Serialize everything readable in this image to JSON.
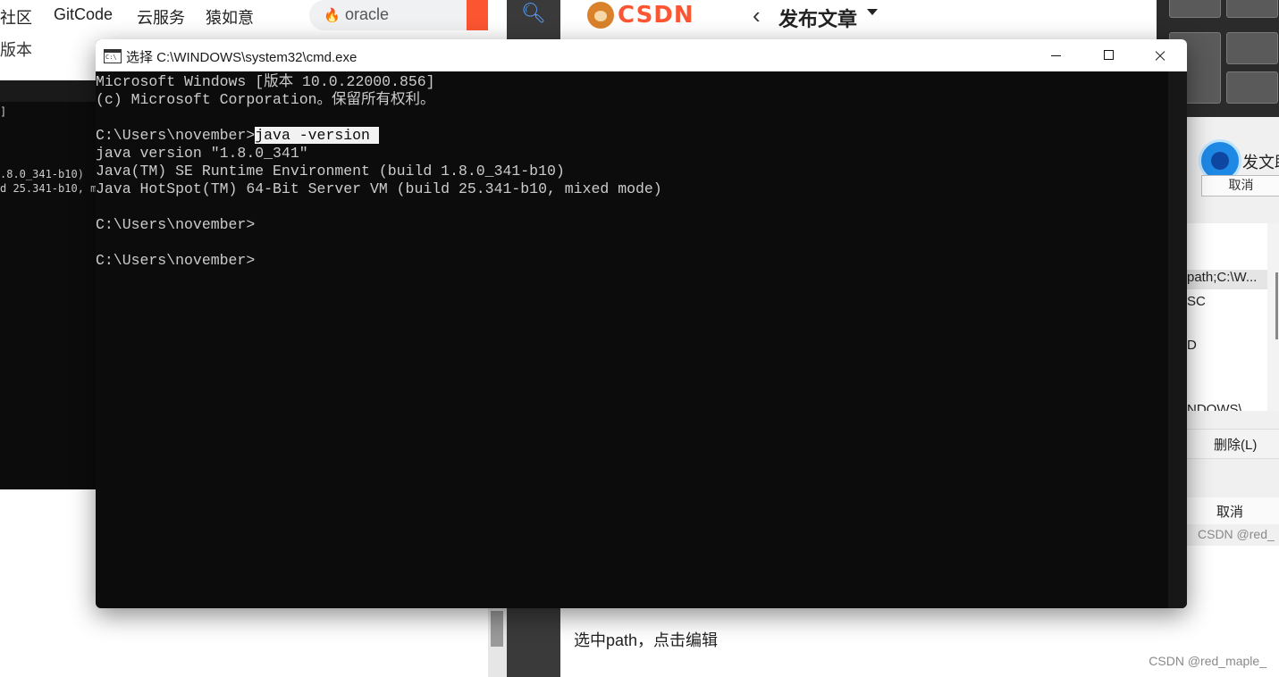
{
  "background": {
    "topnav": {
      "items": [
        "社区",
        "GitCode",
        "云服务",
        "猿如意"
      ],
      "search_value": "oracle"
    },
    "left_fragment": "版本",
    "left_cmd_lines": [
      "]",
      ".8.0_341-b10)",
      "d 25.341-b10, m"
    ],
    "csdn": {
      "logo_text": "CSDN",
      "page_title": "发布文章"
    },
    "right_panel": {
      "fawen": "发文助手",
      "top_button": "取消",
      "list_rows": [
        "path;C:\\W...",
        "SC",
        "D",
        "NDOWS\\"
      ],
      "delete_button": "删除(L)",
      "cancel_button": "取消",
      "watermark": "CSDN @red_"
    },
    "caption": "选中path，点击编辑",
    "watermark": "CSDN @red_maple_"
  },
  "cmd": {
    "title": "选择 C:\\WINDOWS\\system32\\cmd.exe",
    "lines": [
      {
        "text": "Microsoft Windows [版本 10.0.22000.856]"
      },
      {
        "text": "(c) Microsoft Corporation。保留所有权利。"
      },
      {
        "text": ""
      },
      {
        "prompt": "C:\\Users\\november>",
        "selected": "java -version "
      },
      {
        "text": "java version \"1.8.0_341\""
      },
      {
        "text": "Java(TM) SE Runtime Environment (build 1.8.0_341-b10)"
      },
      {
        "text": "Java HotSpot(TM) 64-Bit Server VM (build 25.341-b10, mixed mode)"
      },
      {
        "text": ""
      },
      {
        "text": "C:\\Users\\november>"
      },
      {
        "text": ""
      },
      {
        "text": "C:\\Users\\november>"
      }
    ]
  },
  "colors": {
    "console_bg": "#0c0c0c",
    "console_text": "#cccccc",
    "csdn_accent": "#fc5531"
  }
}
